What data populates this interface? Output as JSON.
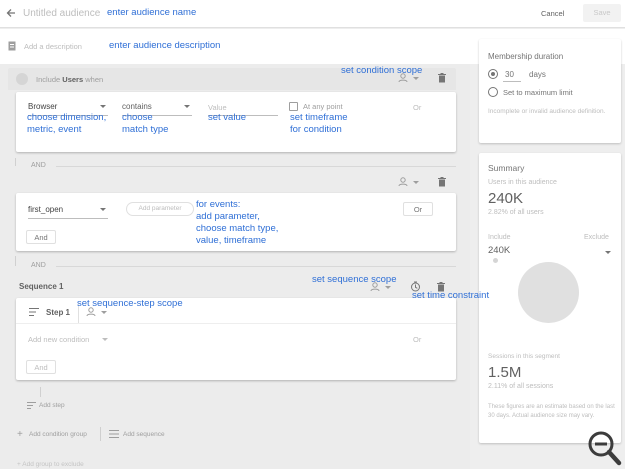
{
  "header": {
    "title": "Untitled audience",
    "cancel": "Cancel",
    "save": "Save"
  },
  "description": {
    "placeholder": "Add a description"
  },
  "condition_group": {
    "include_prefix": "Include",
    "scope_entity": "Users",
    "scope_suffix": "when",
    "dimension": "Browser",
    "match_type": "contains",
    "value_placeholder": "Value",
    "timeframe": "At any point",
    "or": "Or"
  },
  "and_label_1": "AND",
  "event_condition": {
    "event": "first_open",
    "add_parameter": "Add parameter",
    "or": "Or",
    "and": "And"
  },
  "and_label_2": "AND",
  "sequence": {
    "title": "Sequence 1",
    "step_label": "Step 1",
    "add_condition": "Add new condition",
    "or": "Or",
    "and": "And",
    "add_step": "Add step"
  },
  "footer": {
    "add_condition_group": "Add condition group",
    "add_sequence": "Add sequence",
    "exclude_group": "Add group to exclude"
  },
  "membership": {
    "title": "Membership duration",
    "value": "30",
    "unit": "days",
    "max_label": "Set to maximum limit",
    "note": "Incomplete or invalid audience definition."
  },
  "summary": {
    "title": "Summary",
    "users_label": "Users in this audience",
    "users_value": "240K",
    "users_pct": "2.82% of all users",
    "include_label": "Include",
    "exclude_label": "Exclude",
    "include_value": "240K",
    "sessions_label": "Sessions in this segment",
    "sessions_value": "1.5M",
    "sessions_pct": "2.11% of all sessions",
    "note": "These figures are an estimate based on the last 30 days. Actual audience size may vary."
  },
  "annotations": {
    "name": "enter audience name",
    "description": "enter audience description",
    "condition_scope": "set condition scope",
    "dimension_1": "choose dimension,",
    "dimension_2": "metric, event",
    "match_1": "choose",
    "match_2": "match type",
    "value": "set value",
    "timeframe_1": "set timeframe",
    "timeframe_2": "for condition",
    "events_1": "for events:",
    "events_2": "add parameter,",
    "events_3": "choose match type,",
    "events_4": "value, timeframe",
    "sequence_scope": "set sequence scope",
    "step_scope": "set sequence-step scope",
    "time_constraint": "set time constraint"
  },
  "icons": [
    "back-arrow-icon",
    "description-icon",
    "users-icon",
    "delete-icon",
    "timer-icon",
    "step-icon",
    "plus-icon",
    "sequence-icon",
    "zoom-out-icon"
  ],
  "colors": {
    "annotation": "#2f6fd6",
    "accent_text": "#757575",
    "chart_circle": "#e0e0e0"
  }
}
